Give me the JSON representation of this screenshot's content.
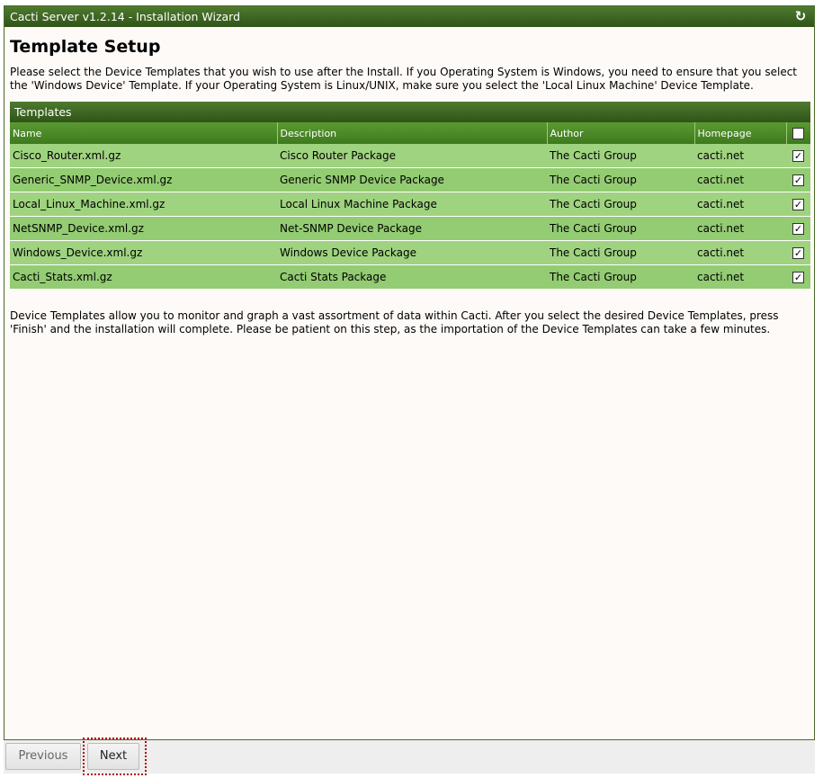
{
  "window": {
    "title": "Cacti Server v1.2.14 - Installation Wizard",
    "refresh_icon": "refresh-icon"
  },
  "page": {
    "heading": "Template Setup",
    "intro": "Please select the Device Templates that you wish to use after the Install. If you Operating System is Windows, you need to ensure that you select the 'Windows Device' Template. If your Operating System is Linux/UNIX, make sure you select the 'Local Linux Machine' Device Template.",
    "outro": "Device Templates allow you to monitor and graph a vast assortment of data within Cacti. After you select the desired Device Templates, press 'Finish' and the installation will complete. Please be patient on this step, as the importation of the Device Templates can take a few minutes."
  },
  "templates": {
    "title": "Templates",
    "columns": [
      "Name",
      "Description",
      "Author",
      "Homepage"
    ],
    "select_all_checked": true,
    "rows": [
      {
        "name": "Cisco_Router.xml.gz",
        "description": "Cisco Router Package",
        "author": "The Cacti Group",
        "homepage": "cacti.net",
        "checked": true
      },
      {
        "name": "Generic_SNMP_Device.xml.gz",
        "description": "Generic SNMP Device Package",
        "author": "The Cacti Group",
        "homepage": "cacti.net",
        "checked": true
      },
      {
        "name": "Local_Linux_Machine.xml.gz",
        "description": "Local Linux Machine Package",
        "author": "The Cacti Group",
        "homepage": "cacti.net",
        "checked": true
      },
      {
        "name": "NetSNMP_Device.xml.gz",
        "description": "Net-SNMP Device Package",
        "author": "The Cacti Group",
        "homepage": "cacti.net",
        "checked": true
      },
      {
        "name": "Windows_Device.xml.gz",
        "description": "Windows Device Package",
        "author": "The Cacti Group",
        "homepage": "cacti.net",
        "checked": true
      },
      {
        "name": "Cacti_Stats.xml.gz",
        "description": "Cacti Stats Package",
        "author": "The Cacti Group",
        "homepage": "cacti.net",
        "checked": true
      }
    ]
  },
  "buttons": {
    "previous": "Previous",
    "next": "Next"
  },
  "colors": {
    "header_dark": "#2f5418",
    "row_green": "#9fd37f",
    "focus_ring": "#b00000"
  }
}
